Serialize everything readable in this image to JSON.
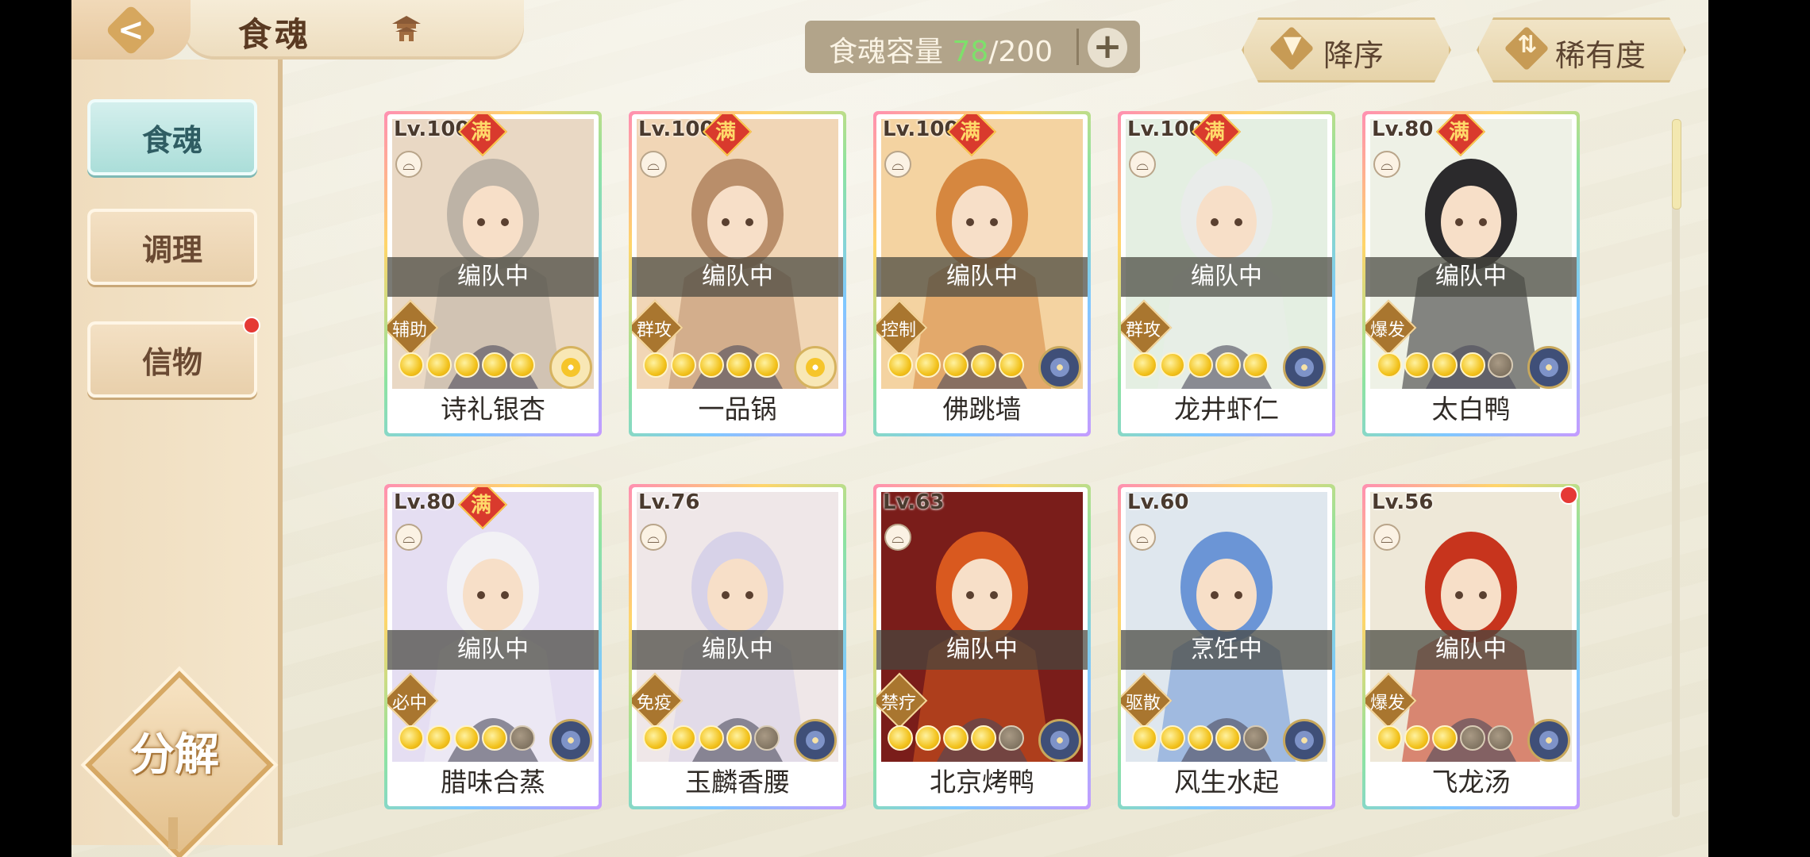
{
  "header": {
    "title": "食魂",
    "back_icon": "back-arrow-icon",
    "home_icon": "pagoda-icon"
  },
  "sidebar": {
    "tabs": [
      {
        "label": "食魂",
        "active": true
      },
      {
        "label": "调理",
        "active": false
      },
      {
        "label": "信物",
        "active": false,
        "notify": true
      }
    ],
    "decompose_label": "分解"
  },
  "capacity": {
    "label": "食魂容量",
    "current": "78",
    "separator": "/",
    "max": "200",
    "add_label": "+"
  },
  "sort": {
    "order_label": "降序",
    "rarity_label": "稀有度"
  },
  "cards": [
    {
      "level": "Lv.100",
      "full": true,
      "full_label": "满",
      "status": "编队中",
      "role": "辅助",
      "stars": 5,
      "element": "light",
      "name": "诗礼银杏",
      "hue": "#e9d8c4",
      "hair": "#bdb3a6"
    },
    {
      "level": "Lv.100",
      "full": true,
      "full_label": "满",
      "status": "编队中",
      "role": "群攻",
      "stars": 5,
      "element": "light",
      "name": "一品锅",
      "hue": "#f1d6b6",
      "hair": "#b98e6a"
    },
    {
      "level": "Lv.100",
      "full": true,
      "full_label": "满",
      "status": "编队中",
      "role": "控制",
      "stars": 5,
      "element": "dark",
      "name": "佛跳墙",
      "hue": "#f4d3a1",
      "hair": "#d6873f"
    },
    {
      "level": "Lv.100",
      "full": true,
      "full_label": "满",
      "status": "编队中",
      "role": "群攻",
      "stars": 5,
      "element": "dark",
      "name": "龙井虾仁",
      "hue": "#e4efe2",
      "hair": "#e9ecea"
    },
    {
      "level": "Lv.80",
      "full": true,
      "full_label": "满",
      "status": "编队中",
      "role": "爆发",
      "stars": 4,
      "element": "dark",
      "name": "太白鸭",
      "hue": "#eef1e6",
      "hair": "#2b2a2c"
    },
    {
      "level": "Lv.80",
      "full": true,
      "full_label": "满",
      "status": "编队中",
      "role": "必中",
      "stars": 4,
      "element": "dark",
      "name": "腊味合蒸",
      "hue": "#e5def2",
      "hair": "#f2f1f5"
    },
    {
      "level": "Lv.76",
      "full": false,
      "full_label": "",
      "status": "编队中",
      "role": "免疫",
      "stars": 4,
      "element": "dark",
      "name": "玉麟香腰",
      "hue": "#efe7e8",
      "hair": "#d7d2e8"
    },
    {
      "level": "Lv.63",
      "full": false,
      "full_label": "",
      "status": "编队中",
      "role": "禁疗",
      "stars": 4,
      "element": "dark",
      "name": "北京烤鸭",
      "hue": "#7a1d1a",
      "hair": "#d9591f"
    },
    {
      "level": "Lv.60",
      "full": false,
      "full_label": "",
      "status": "烹饪中",
      "role": "驱散",
      "stars": 4,
      "element": "dark",
      "name": "风生水起",
      "hue": "#dfe7ee",
      "hair": "#6b95d6"
    },
    {
      "level": "Lv.56",
      "full": false,
      "full_label": "",
      "status": "编队中",
      "role": "爆发",
      "stars": 3,
      "element": "dark",
      "name": "飞龙汤",
      "hue": "#eee8d8",
      "hair": "#c7341d",
      "notify": true
    }
  ]
}
